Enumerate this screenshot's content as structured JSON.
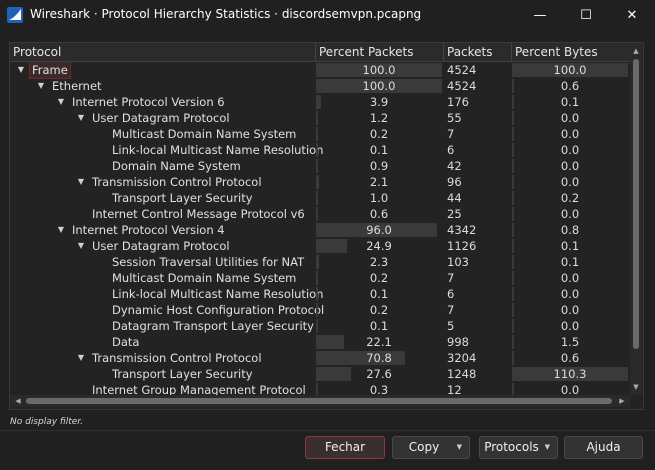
{
  "window": {
    "title": "Wireshark · Protocol Hierarchy Statistics · discordsemvpn.pcapng",
    "minimize": "—",
    "maximize": "☐",
    "close": "✕"
  },
  "table": {
    "columns": [
      "Protocol",
      "Percent Packets",
      "Packets",
      "Percent Bytes"
    ],
    "rows": [
      {
        "name": "Frame",
        "level": 0,
        "expander": "expanded",
        "percent_packets": "100.0",
        "packets": "4524",
        "percent_bytes": "100.0",
        "selected": true
      },
      {
        "name": "Ethernet",
        "level": 1,
        "expander": "expanded",
        "percent_packets": "100.0",
        "packets": "4524",
        "percent_bytes": "0.6"
      },
      {
        "name": "Internet Protocol Version 6",
        "level": 2,
        "expander": "expanded",
        "percent_packets": "3.9",
        "packets": "176",
        "percent_bytes": "0.1"
      },
      {
        "name": "User Datagram Protocol",
        "level": 3,
        "expander": "expanded",
        "percent_packets": "1.2",
        "packets": "55",
        "percent_bytes": "0.0"
      },
      {
        "name": "Multicast Domain Name System",
        "level": 4,
        "expander": "none",
        "percent_packets": "0.2",
        "packets": "7",
        "percent_bytes": "0.0"
      },
      {
        "name": "Link-local Multicast Name Resolution",
        "level": 4,
        "expander": "none",
        "percent_packets": "0.1",
        "packets": "6",
        "percent_bytes": "0.0"
      },
      {
        "name": "Domain Name System",
        "level": 4,
        "expander": "none",
        "percent_packets": "0.9",
        "packets": "42",
        "percent_bytes": "0.0"
      },
      {
        "name": "Transmission Control Protocol",
        "level": 3,
        "expander": "expanded",
        "percent_packets": "2.1",
        "packets": "96",
        "percent_bytes": "0.0"
      },
      {
        "name": "Transport Layer Security",
        "level": 4,
        "expander": "none",
        "percent_packets": "1.0",
        "packets": "44",
        "percent_bytes": "0.2"
      },
      {
        "name": "Internet Control Message Protocol v6",
        "level": 3,
        "expander": "none",
        "percent_packets": "0.6",
        "packets": "25",
        "percent_bytes": "0.0"
      },
      {
        "name": "Internet Protocol Version 4",
        "level": 2,
        "expander": "expanded",
        "percent_packets": "96.0",
        "packets": "4342",
        "percent_bytes": "0.8"
      },
      {
        "name": "User Datagram Protocol",
        "level": 3,
        "expander": "expanded",
        "percent_packets": "24.9",
        "packets": "1126",
        "percent_bytes": "0.1"
      },
      {
        "name": "Session Traversal Utilities for NAT",
        "level": 4,
        "expander": "none",
        "percent_packets": "2.3",
        "packets": "103",
        "percent_bytes": "0.1"
      },
      {
        "name": "Multicast Domain Name System",
        "level": 4,
        "expander": "none",
        "percent_packets": "0.2",
        "packets": "7",
        "percent_bytes": "0.0"
      },
      {
        "name": "Link-local Multicast Name Resolution",
        "level": 4,
        "expander": "none",
        "percent_packets": "0.1",
        "packets": "6",
        "percent_bytes": "0.0"
      },
      {
        "name": "Dynamic Host Configuration Protocol",
        "level": 4,
        "expander": "none",
        "percent_packets": "0.2",
        "packets": "7",
        "percent_bytes": "0.0"
      },
      {
        "name": "Datagram Transport Layer Security",
        "level": 4,
        "expander": "none",
        "percent_packets": "0.1",
        "packets": "5",
        "percent_bytes": "0.0"
      },
      {
        "name": "Data",
        "level": 4,
        "expander": "none",
        "percent_packets": "22.1",
        "packets": "998",
        "percent_bytes": "1.5"
      },
      {
        "name": "Transmission Control Protocol",
        "level": 3,
        "expander": "expanded",
        "percent_packets": "70.8",
        "packets": "3204",
        "percent_bytes": "0.6"
      },
      {
        "name": "Transport Layer Security",
        "level": 4,
        "expander": "none",
        "percent_packets": "27.6",
        "packets": "1248",
        "percent_bytes": "110.3"
      },
      {
        "name": "Internet Group Management Protocol",
        "level": 3,
        "expander": "none",
        "percent_packets": "0.3",
        "packets": "12",
        "percent_bytes": "0.0"
      }
    ]
  },
  "status": {
    "filter_text": "No display filter."
  },
  "buttons": {
    "fechar": "Fechar",
    "copy": "Copy",
    "protocols": "Protocols",
    "ajuda": "Ajuda"
  },
  "icons": {
    "app": "wireshark-fin-icon",
    "expanded": "triangle-down-icon",
    "dropdown": "caret-down-icon"
  },
  "colors": {
    "background": "#202020",
    "bar": "#3a3a3a",
    "selection_outline": "#6b2a26",
    "primary_button_border": "#8a3b32"
  }
}
